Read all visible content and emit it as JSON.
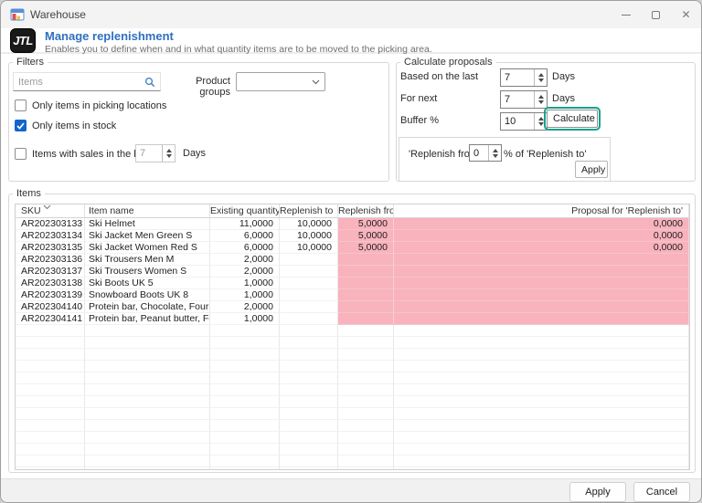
{
  "window": {
    "title": "Warehouse"
  },
  "icons": {
    "close_glyph": "✕",
    "minimize": "minus-line",
    "maximize": "square-outline",
    "search": "magnifier",
    "combo_chevron": "chevron-down",
    "sort": "chevron-down"
  },
  "header": {
    "logo_text": "JTL",
    "title": "Manage replenishment",
    "subtitle": "Enables you to define when and in what quantity items are to be moved to the picking area."
  },
  "filters": {
    "section_title": "Filters",
    "search_placeholder": "Items",
    "product_groups_label": "Product groups",
    "product_groups_value": "",
    "checkboxes": [
      {
        "label": "Only items in picking locations",
        "checked": false
      },
      {
        "label": "Only items in stock",
        "checked": true
      },
      {
        "label": "Items with sales in the last",
        "checked": false
      }
    ],
    "sales_days_value": "7",
    "sales_days_unit": "Days"
  },
  "proposals": {
    "section_title": "Calculate proposals",
    "rows": [
      {
        "label": "Based on the last",
        "value": "7",
        "unit": "Days"
      },
      {
        "label": "For next",
        "value": "7",
        "unit": "Days"
      },
      {
        "label": "Buffer %",
        "value": "10",
        "unit": ""
      }
    ],
    "calculate_button": "Calculate",
    "replenish_panel": {
      "prefix": "'Replenish from' to",
      "value": "0",
      "suffix": "% of 'Replenish to'",
      "apply_button": "Apply"
    }
  },
  "items": {
    "section_title": "Items",
    "columns": [
      "SKU",
      "Item name",
      "Existing quantity",
      "Replenish to",
      "Replenish from",
      "Proposal for 'Replenish to'"
    ],
    "rows": [
      {
        "sku": "AR202303133",
        "name": "Ski Helmet",
        "existing": "11,0000",
        "replenish_to": "10,0000",
        "replenish_from": "5,0000",
        "proposal": "0,0000"
      },
      {
        "sku": "AR202303134",
        "name": "Ski Jacket Men Green S",
        "existing": "6,0000",
        "replenish_to": "10,0000",
        "replenish_from": "5,0000",
        "proposal": "0,0000"
      },
      {
        "sku": "AR202303135",
        "name": "Ski Jacket Women Red S",
        "existing": "6,0000",
        "replenish_to": "10,0000",
        "replenish_from": "5,0000",
        "proposal": "0,0000"
      },
      {
        "sku": "AR202303136",
        "name": "Ski Trousers Men M",
        "existing": "2,0000",
        "replenish_to": "",
        "replenish_from": "",
        "proposal": ""
      },
      {
        "sku": "AR202303137",
        "name": "Ski Trousers Women S",
        "existing": "2,0000",
        "replenish_to": "",
        "replenish_from": "",
        "proposal": ""
      },
      {
        "sku": "AR202303138",
        "name": "Ski Boots UK 5",
        "existing": "1,0000",
        "replenish_to": "",
        "replenish_from": "",
        "proposal": ""
      },
      {
        "sku": "AR202303139",
        "name": "Snowboard Boots UK 8",
        "existing": "1,0000",
        "replenish_to": "",
        "replenish_from": "",
        "proposal": ""
      },
      {
        "sku": "AR202304140",
        "name": "Protein bar, Chocolate, Four-pack",
        "existing": "2,0000",
        "replenish_to": "",
        "replenish_from": "",
        "proposal": ""
      },
      {
        "sku": "AR202304141",
        "name": "Protein bar, Peanut butter, Four-p...",
        "existing": "1,0000",
        "replenish_to": "",
        "replenish_from": "",
        "proposal": ""
      }
    ]
  },
  "footer": {
    "apply": "Apply",
    "cancel": "Cancel"
  },
  "colors": {
    "title_blue": "#2e70c0",
    "accent_teal": "#18a08c",
    "highlight_pink": "#f8b3bd",
    "checkbox_blue": "#1166cb"
  }
}
